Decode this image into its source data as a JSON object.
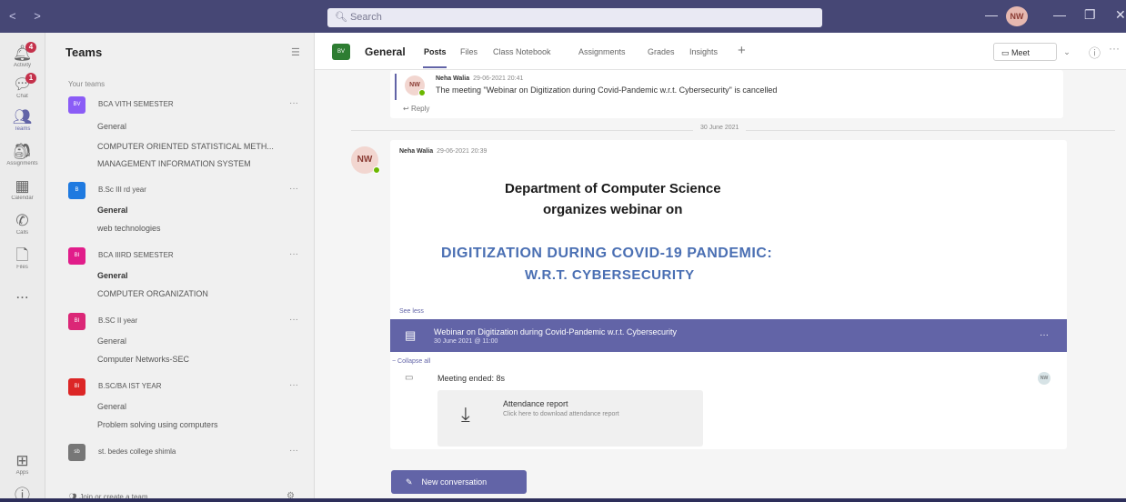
{
  "titlebar": {
    "nav": "< >",
    "search_placeholder": "Search",
    "user_initials": "NW",
    "minimize": "—",
    "restore": "❐",
    "close": "✕"
  },
  "rail": {
    "items": [
      {
        "label": "Activity",
        "icon": "bell-icon",
        "badge": "4"
      },
      {
        "label": "Chat",
        "icon": "chat-icon",
        "badge": "1"
      },
      {
        "label": "Teams",
        "icon": "teams-icon",
        "badge": ""
      },
      {
        "label": "Assignments",
        "icon": "assignments-icon",
        "badge": ""
      },
      {
        "label": "Calendar",
        "icon": "calendar-icon",
        "badge": ""
      },
      {
        "label": "Calls",
        "icon": "phone-icon",
        "badge": ""
      },
      {
        "label": "Files",
        "icon": "file-icon",
        "badge": ""
      },
      {
        "label": "...",
        "icon": "more-icon",
        "badge": ""
      },
      {
        "label": "Apps",
        "icon": "apps-icon",
        "badge": ""
      },
      {
        "label": "",
        "icon": "help-icon",
        "badge": ""
      }
    ]
  },
  "teams_panel": {
    "title": "Teams",
    "your_teams": "Your teams",
    "teams": [
      {
        "name": "BCA VITH SEMESTER",
        "color": "#8b5cf6",
        "abbr": "BV",
        "channels": [
          {
            "name": "General",
            "bold": false
          },
          {
            "name": "COMPUTER ORIENTED STATISTICAL METH...",
            "bold": false
          },
          {
            "name": "MANAGEMENT INFORMATION SYSTEM",
            "bold": false
          }
        ]
      },
      {
        "name": "B.Sc III rd year",
        "color": "#1f7ae0",
        "abbr": "B",
        "channels": [
          {
            "name": "General",
            "bold": true
          },
          {
            "name": "web technologies",
            "bold": false
          }
        ]
      },
      {
        "name": "BCA IIIRD SEMESTER",
        "color": "#e11d8a",
        "abbr": "BI",
        "channels": [
          {
            "name": "General",
            "bold": true
          },
          {
            "name": "COMPUTER ORGANIZATION",
            "bold": false
          }
        ]
      },
      {
        "name": "B.SC II year",
        "color": "#db2777",
        "abbr": "BI",
        "channels": [
          {
            "name": "General",
            "bold": false
          },
          {
            "name": "Computer Networks-SEC",
            "bold": false
          }
        ]
      },
      {
        "name": "B.SC/BA IST YEAR",
        "color": "#dc2626",
        "abbr": "BI",
        "channels": [
          {
            "name": "General",
            "bold": false
          },
          {
            "name": "Problem solving using computers",
            "bold": false
          }
        ]
      },
      {
        "name": "st. bedes college shimla",
        "color": "#777777",
        "abbr": "sb",
        "channels": []
      }
    ],
    "join_label": "Join or create a team"
  },
  "channel": {
    "icon_abbr": "BV",
    "name": "General",
    "tabs": [
      "Posts",
      "Files",
      "Class Notebook",
      "Assignments",
      "Grades",
      "Insights"
    ],
    "add_tab": "+",
    "meet_label": "Meet",
    "caret": "⌄"
  },
  "messages": {
    "msg1": {
      "initials": "NW",
      "author": "Neha Walia",
      "time": "29-06-2021 20:41",
      "text": "The meeting \"Webinar on Digitization during Covid-Pandemic w.r.t. Cybersecurity\" is cancelled",
      "reply": "Reply"
    },
    "date_divider": "30 June 2021",
    "msg2": {
      "initials": "NW",
      "author": "Neha Walia",
      "time": "29-06-2021 20:39",
      "poster_line1": "Department of Computer Science",
      "poster_line2": "organizes webinar on",
      "poster_line3": "DIGITIZATION DURING COVID-19 PANDEMIC:",
      "poster_line4": "W.R.T. CYBERSECURITY",
      "see_less": "See less",
      "meeting_title": "Webinar on Digitization during Covid-Pandemic w.r.t. Cybersecurity",
      "meeting_date": "30 June 2021 @ 11:00",
      "collapse_all": "Collapse all",
      "meeting_ended": "Meeting ended: 8s",
      "participant_initials": "NW",
      "attendance_title": "Attendance report",
      "attendance_sub": "Click here to download attendance report"
    }
  },
  "new_conversation": "New conversation",
  "colors": {
    "brand": "#6264a7",
    "titlebar": "#464775"
  }
}
